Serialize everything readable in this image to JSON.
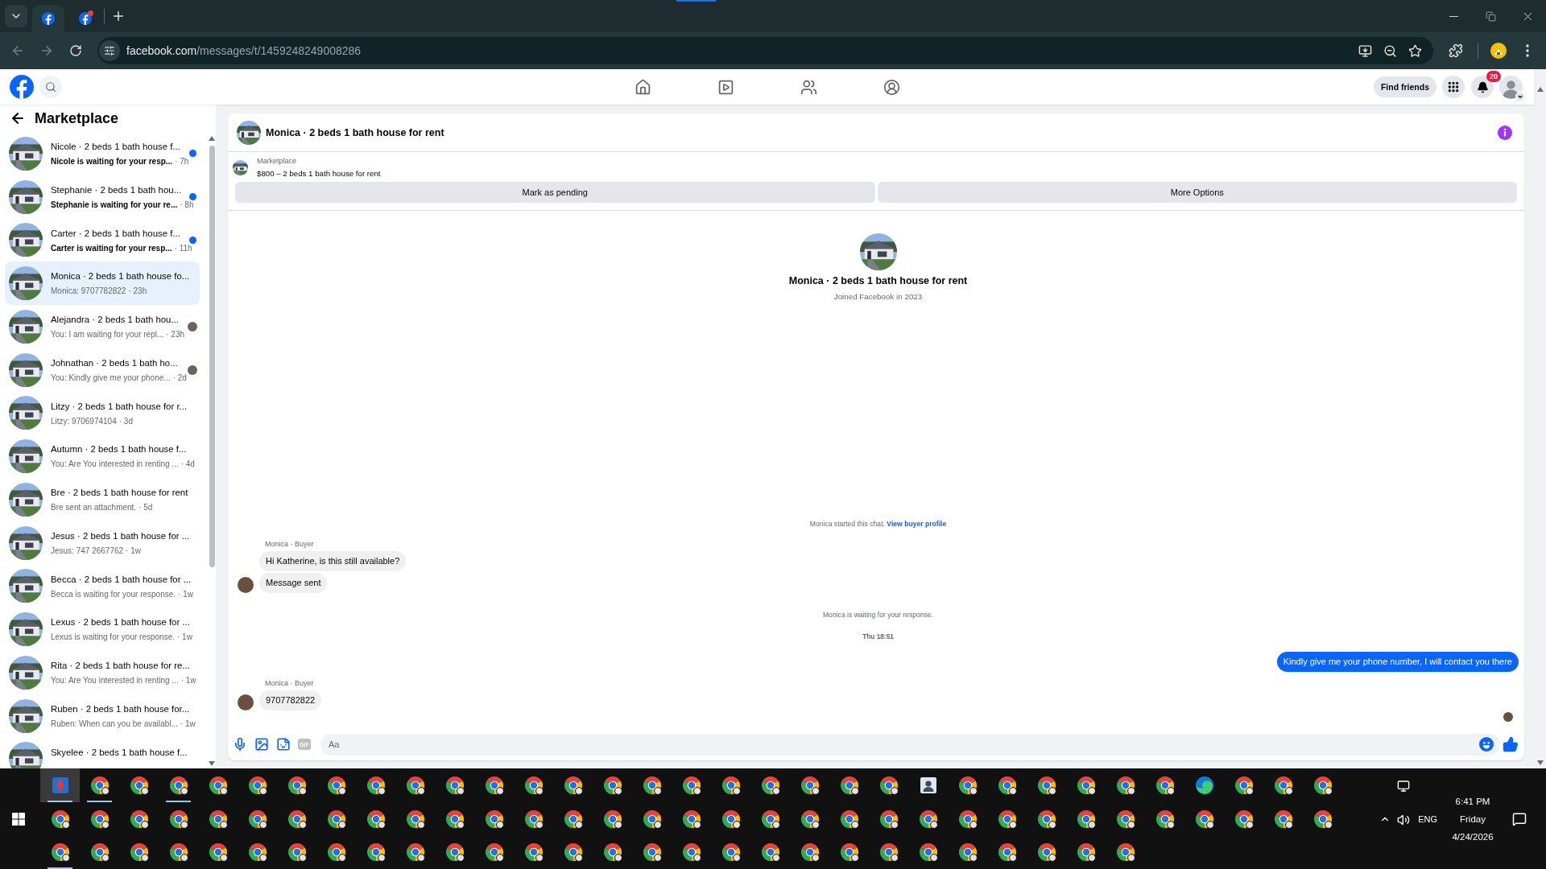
{
  "browser": {
    "tabs": [
      {
        "selected": true,
        "alert": false
      },
      {
        "selected": false,
        "alert": true
      }
    ],
    "back_disabled": true,
    "forward_disabled": true,
    "url_host": "facebook.com",
    "url_path": "/messages/t/1459248249008286"
  },
  "topbar": {
    "find_friends": "Find friends",
    "notification_count": "20"
  },
  "sidebar": {
    "title": "Marketplace",
    "conversations": [
      {
        "title": "Nicole · 2 beds 1 bath house f...",
        "preview": "Nicole is waiting for your resp...",
        "time": "· 7h",
        "unread": true,
        "seen": false,
        "selected": false
      },
      {
        "title": "Stephanie · 2 beds 1 bath hou...",
        "preview": "Stephanie is waiting for your re...",
        "time": "· 8h",
        "unread": true,
        "seen": false,
        "selected": false
      },
      {
        "title": "Carter · 2 beds 1 bath house f...",
        "preview": "Carter is waiting for your resp...",
        "time": "· 11h",
        "unread": true,
        "seen": false,
        "selected": false
      },
      {
        "title": "Monica · 2 beds 1 bath house fo...",
        "preview": "Monica: 9707782822",
        "time": "· 23h",
        "unread": false,
        "seen": false,
        "selected": true
      },
      {
        "title": "Alejandra · 2 beds 1 bath hou...",
        "preview": "You: I am waiting for your repl...",
        "time": "· 23h",
        "unread": false,
        "seen": true,
        "selected": false
      },
      {
        "title": "Johnathan · 2 beds 1 bath ho...",
        "preview": "You: Kindly give me your phone...",
        "time": "· 2d",
        "unread": false,
        "seen": true,
        "selected": false
      },
      {
        "title": "Litzy · 2 beds 1 bath house for r...",
        "preview": "Litzy: 9706974104",
        "time": "· 3d",
        "unread": false,
        "seen": false,
        "selected": false
      },
      {
        "title": "Autumn · 2 beds 1 bath house f...",
        "preview": "You: Are You interested in renting ...",
        "time": "· 4d",
        "unread": false,
        "seen": false,
        "selected": false
      },
      {
        "title": "Bre · 2 beds 1 bath house for rent",
        "preview": "Bre sent an attachment.",
        "time": "· 5d",
        "unread": false,
        "seen": false,
        "selected": false
      },
      {
        "title": "Jesus · 2 beds 1 bath house for ...",
        "preview": "Jesus: 747 2667762",
        "time": "· 1w",
        "unread": false,
        "seen": false,
        "selected": false
      },
      {
        "title": "Becca · 2 beds 1 bath house for ...",
        "preview": "Becca is waiting for your response.",
        "time": "· 1w",
        "unread": false,
        "seen": false,
        "selected": false
      },
      {
        "title": "Lexus · 2 beds 1 bath house for ...",
        "preview": "Lexus is waiting for your response.",
        "time": "· 1w",
        "unread": false,
        "seen": false,
        "selected": false
      },
      {
        "title": "Rita · 2 beds 1 bath house for re...",
        "preview": "You: Are You interested in renting ...",
        "time": "· 1w",
        "unread": false,
        "seen": false,
        "selected": false
      },
      {
        "title": "Ruben · 2 beds 1 bath house for...",
        "preview": "Ruben: When can you be availabl...",
        "time": "· 1w",
        "unread": false,
        "seen": false,
        "selected": false
      },
      {
        "title": "Skyelee · 2 beds 1 bath house f...",
        "unread": false,
        "seen": false,
        "selected": false
      }
    ]
  },
  "chat": {
    "title": "Monica · 2 beds 1 bath house for rent",
    "listing": {
      "source": "Marketplace",
      "item": "$800 – 2 beds 1 bath house for rent"
    },
    "actions": [
      "Mark as pending",
      "More Options"
    ],
    "profile": {
      "name": "Monica · 2 beds 1 bath house for rent",
      "joined": "Joined Facebook in 2023"
    },
    "messages": [
      {
        "kind": "notice",
        "text": "Monica started this chat.",
        "link": "View buyer profile"
      },
      {
        "kind": "sender",
        "text": "Monica · Buyer"
      },
      {
        "kind": "incoming",
        "text": "Hi Katherine, is this still available?",
        "avatar": false
      },
      {
        "kind": "incoming",
        "text": "Message sent",
        "avatar": true
      },
      {
        "kind": "notice",
        "text": "Monica is waiting for your response."
      },
      {
        "kind": "time",
        "text": "Thu 18:51"
      },
      {
        "kind": "outgoing",
        "text": "Kindly give me your phone number, I will contact you there"
      },
      {
        "kind": "sender",
        "text": "Monica · Buyer"
      },
      {
        "kind": "incoming",
        "text": "9707782822",
        "avatar": true
      },
      {
        "kind": "seen"
      }
    ],
    "composer": {
      "gif": "GIF",
      "placeholder": "Aa"
    }
  },
  "taskbar": {
    "rows": [
      [
        {
          "kind": "app",
          "running": true,
          "selected": true
        },
        {
          "kind": "chrome",
          "running": true,
          "selected": false
        },
        {
          "kind": "chrome",
          "running": false,
          "selected": false
        },
        {
          "kind": "chrome",
          "running": true,
          "selected": false
        },
        {
          "kind": "chrome",
          "running": false,
          "selected": false
        },
        {
          "kind": "chrome",
          "running": false,
          "selected": false
        },
        {
          "kind": "chrome",
          "running": false,
          "selected": false
        },
        {
          "kind": "chrome",
          "running": false,
          "selected": false
        },
        {
          "kind": "chrome",
          "running": false,
          "selected": false
        },
        {
          "kind": "chrome",
          "running": false,
          "selected": false
        },
        {
          "kind": "chrome",
          "running": false,
          "selected": false
        },
        {
          "kind": "chrome",
          "running": false,
          "selected": false
        },
        {
          "kind": "chrome",
          "running": false,
          "selected": false
        },
        {
          "kind": "chrome",
          "running": false,
          "selected": false
        },
        {
          "kind": "chrome",
          "running": false,
          "selected": false
        },
        {
          "kind": "chrome",
          "running": false,
          "selected": false
        },
        {
          "kind": "chrome",
          "running": false,
          "selected": false
        },
        {
          "kind": "chrome",
          "running": false,
          "selected": false
        },
        {
          "kind": "chrome",
          "running": false,
          "selected": false
        },
        {
          "kind": "chrome",
          "running": false,
          "selected": false
        },
        {
          "kind": "chrome",
          "running": false,
          "selected": false
        },
        {
          "kind": "chrome",
          "running": false,
          "selected": false
        },
        {
          "kind": "contacts",
          "running": false,
          "selected": false
        },
        {
          "kind": "chrome",
          "running": false,
          "selected": false
        },
        {
          "kind": "chrome",
          "running": false,
          "selected": false
        },
        {
          "kind": "chrome",
          "running": false,
          "selected": false
        },
        {
          "kind": "chrome",
          "running": false,
          "selected": false
        },
        {
          "kind": "chrome",
          "running": false,
          "selected": false
        },
        {
          "kind": "chrome",
          "running": false,
          "selected": false
        },
        {
          "kind": "edge",
          "running": false,
          "selected": false
        },
        {
          "kind": "chrome",
          "running": false,
          "selected": false
        },
        {
          "kind": "chrome",
          "running": false,
          "selected": false
        },
        {
          "kind": "chrome",
          "running": false,
          "selected": false
        }
      ],
      [
        {
          "kind": "chrome",
          "running": false,
          "selected": false
        },
        {
          "kind": "chrome",
          "running": false,
          "selected": false
        },
        {
          "kind": "chrome",
          "running": false,
          "selected": false
        },
        {
          "kind": "chrome",
          "running": false,
          "selected": false
        },
        {
          "kind": "chrome",
          "running": false,
          "selected": false
        },
        {
          "kind": "chrome",
          "running": false,
          "selected": false
        },
        {
          "kind": "chrome",
          "running": false,
          "selected": false
        },
        {
          "kind": "chrome",
          "running": false,
          "selected": false
        },
        {
          "kind": "chrome",
          "running": false,
          "selected": false
        },
        {
          "kind": "chrome",
          "running": false,
          "selected": false
        },
        {
          "kind": "chrome",
          "running": false,
          "selected": false
        },
        {
          "kind": "chrome",
          "running": false,
          "selected": false
        },
        {
          "kind": "chrome",
          "running": false,
          "selected": false
        },
        {
          "kind": "chrome",
          "running": false,
          "selected": false
        },
        {
          "kind": "chrome",
          "running": false,
          "selected": false
        },
        {
          "kind": "chrome",
          "running": false,
          "selected": false
        },
        {
          "kind": "chrome",
          "running": false,
          "selected": false
        },
        {
          "kind": "chrome",
          "running": false,
          "selected": false
        },
        {
          "kind": "chrome",
          "running": false,
          "selected": false
        },
        {
          "kind": "chrome",
          "running": false,
          "selected": false
        },
        {
          "kind": "chrome",
          "running": false,
          "selected": false
        },
        {
          "kind": "chrome",
          "running": false,
          "selected": false
        },
        {
          "kind": "chrome",
          "running": false,
          "selected": false
        },
        {
          "kind": "chrome",
          "running": false,
          "selected": false
        },
        {
          "kind": "chrome",
          "running": false,
          "selected": false
        },
        {
          "kind": "chrome",
          "running": false,
          "selected": false
        },
        {
          "kind": "chrome",
          "running": false,
          "selected": false
        },
        {
          "kind": "chrome",
          "running": false,
          "selected": false
        },
        {
          "kind": "chrome",
          "running": false,
          "selected": false
        },
        {
          "kind": "chrome",
          "running": false,
          "selected": false
        },
        {
          "kind": "chrome",
          "running": false,
          "selected": false
        },
        {
          "kind": "chrome",
          "running": false,
          "selected": false
        },
        {
          "kind": "chrome",
          "running": false,
          "selected": false
        }
      ],
      [
        {
          "kind": "chrome",
          "running": true,
          "selected": false
        },
        {
          "kind": "chrome",
          "running": false,
          "selected": false
        },
        {
          "kind": "chrome",
          "running": false,
          "selected": false
        },
        {
          "kind": "chrome",
          "running": false,
          "selected": false
        },
        {
          "kind": "chrome",
          "running": false,
          "selected": false
        },
        {
          "kind": "chrome",
          "running": false,
          "selected": false
        },
        {
          "kind": "chrome",
          "running": false,
          "selected": false
        },
        {
          "kind": "chrome",
          "running": false,
          "selected": false
        },
        {
          "kind": "chrome",
          "running": false,
          "selected": false
        },
        {
          "kind": "chrome",
          "running": false,
          "selected": false
        },
        {
          "kind": "chrome",
          "running": false,
          "selected": false
        },
        {
          "kind": "chrome",
          "running": false,
          "selected": false
        },
        {
          "kind": "chrome",
          "running": false,
          "selected": false
        },
        {
          "kind": "chrome",
          "running": false,
          "selected": false
        },
        {
          "kind": "chrome",
          "running": false,
          "selected": false
        },
        {
          "kind": "chrome",
          "running": false,
          "selected": false
        },
        {
          "kind": "chrome",
          "running": false,
          "selected": false
        },
        {
          "kind": "chrome",
          "running": false,
          "selected": false
        },
        {
          "kind": "chrome",
          "running": false,
          "selected": false
        },
        {
          "kind": "chrome",
          "running": false,
          "selected": false
        },
        {
          "kind": "chrome",
          "running": false,
          "selected": false
        },
        {
          "kind": "chrome",
          "running": false,
          "selected": false
        },
        {
          "kind": "chrome",
          "running": false,
          "selected": false
        },
        {
          "kind": "chrome",
          "running": false,
          "selected": false
        },
        {
          "kind": "chrome",
          "running": false,
          "selected": false
        },
        {
          "kind": "chrome",
          "running": false,
          "selected": false
        },
        {
          "kind": "chrome",
          "running": false,
          "selected": false
        },
        {
          "kind": "chrome",
          "running": false,
          "selected": false
        }
      ]
    ],
    "tray": {
      "language": "ENG",
      "time": "6:41 PM",
      "day": "Friday",
      "date": "4/24/2026"
    }
  }
}
